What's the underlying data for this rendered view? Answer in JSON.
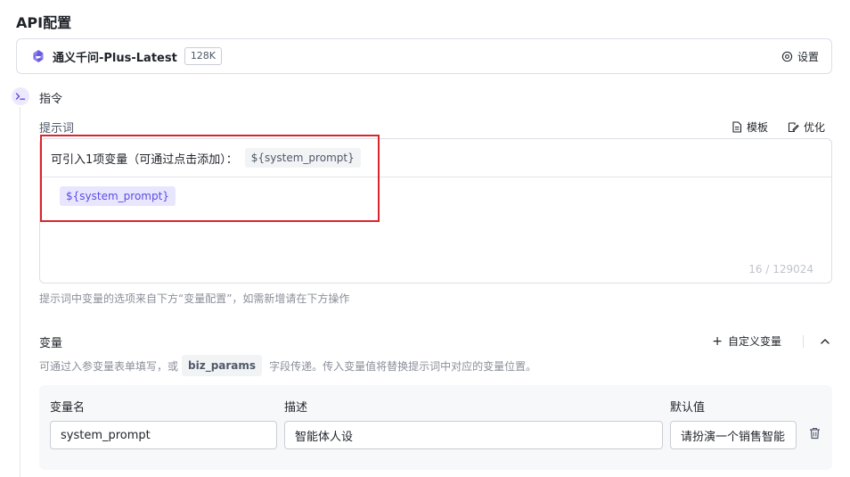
{
  "section_title": "API配置",
  "model": {
    "name": "通义千问-Plus-Latest",
    "context_badge": "128K",
    "settings_label": "设置",
    "logo_icon": "qwen-logo-icon"
  },
  "instruction": {
    "title": "指令",
    "icon": "terminal-icon"
  },
  "prompt": {
    "label": "提示词",
    "toolbar": {
      "template_label": "模板",
      "optimize_label": "优化"
    },
    "variable_hint": "可引入1项变量（可通过点击添加）：",
    "variable_chip": "${system_prompt}",
    "content_chip": "${system_prompt}",
    "char_count": "16 / 129024",
    "help_text": "提示词中变量的选项来自下方“变量配置”，如需新增请在下方操作"
  },
  "variables": {
    "title": "变量",
    "add_label": "自定义变量",
    "desc_before": "可通过入参变量表单填写，或",
    "desc_code": "biz_params",
    "desc_after": "字段传递。传入变量值将替换提示词中对应的变量位置。",
    "columns": {
      "name": "变量名",
      "description": "描述",
      "default": "默认值"
    },
    "rows": [
      {
        "name": "system_prompt",
        "description": "智能体人设",
        "default": "请扮演一个销售智能"
      }
    ]
  },
  "colors": {
    "accent_purple": "#5b4de0",
    "highlight_red": "#d9262c"
  }
}
